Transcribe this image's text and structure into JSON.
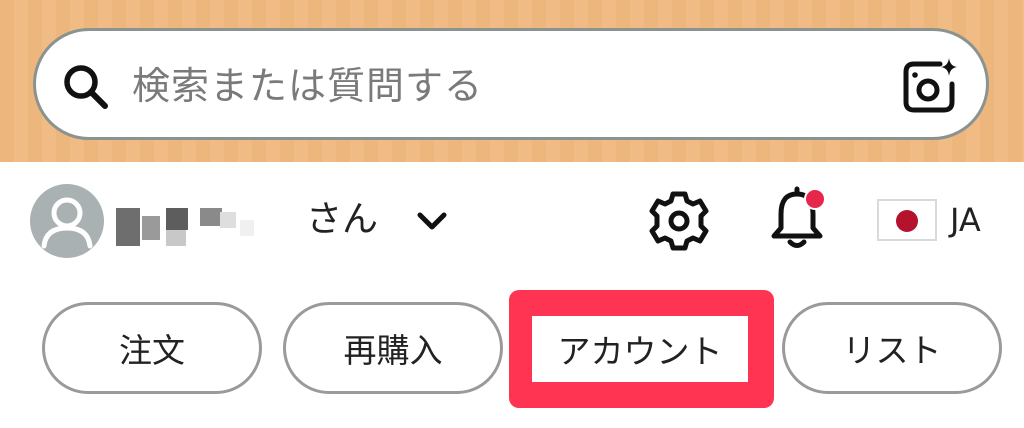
{
  "search": {
    "placeholder": "検索または質問する",
    "leading_icon": "search-icon",
    "trailing_icon": "camera-sparkle-icon"
  },
  "account": {
    "avatar_icon": "user-avatar-icon",
    "honorific": "さん",
    "dropdown_icon": "chevron-down-icon"
  },
  "header_actions": {
    "settings_icon": "gear-icon",
    "notifications_icon": "bell-icon",
    "has_unread": true,
    "flag_icon": "japan-flag-icon",
    "language": "JA"
  },
  "tabs": [
    {
      "label": "注文"
    },
    {
      "label": "再購入"
    },
    {
      "label": "アカウント",
      "highlighted": true
    },
    {
      "label": "リスト"
    }
  ],
  "colors": {
    "header_band": "#EDB67D",
    "highlight": "#FF3452",
    "notification_dot": "#E6264A",
    "flag_disc": "#B5122E",
    "avatar_bg": "#A9B1B3"
  }
}
